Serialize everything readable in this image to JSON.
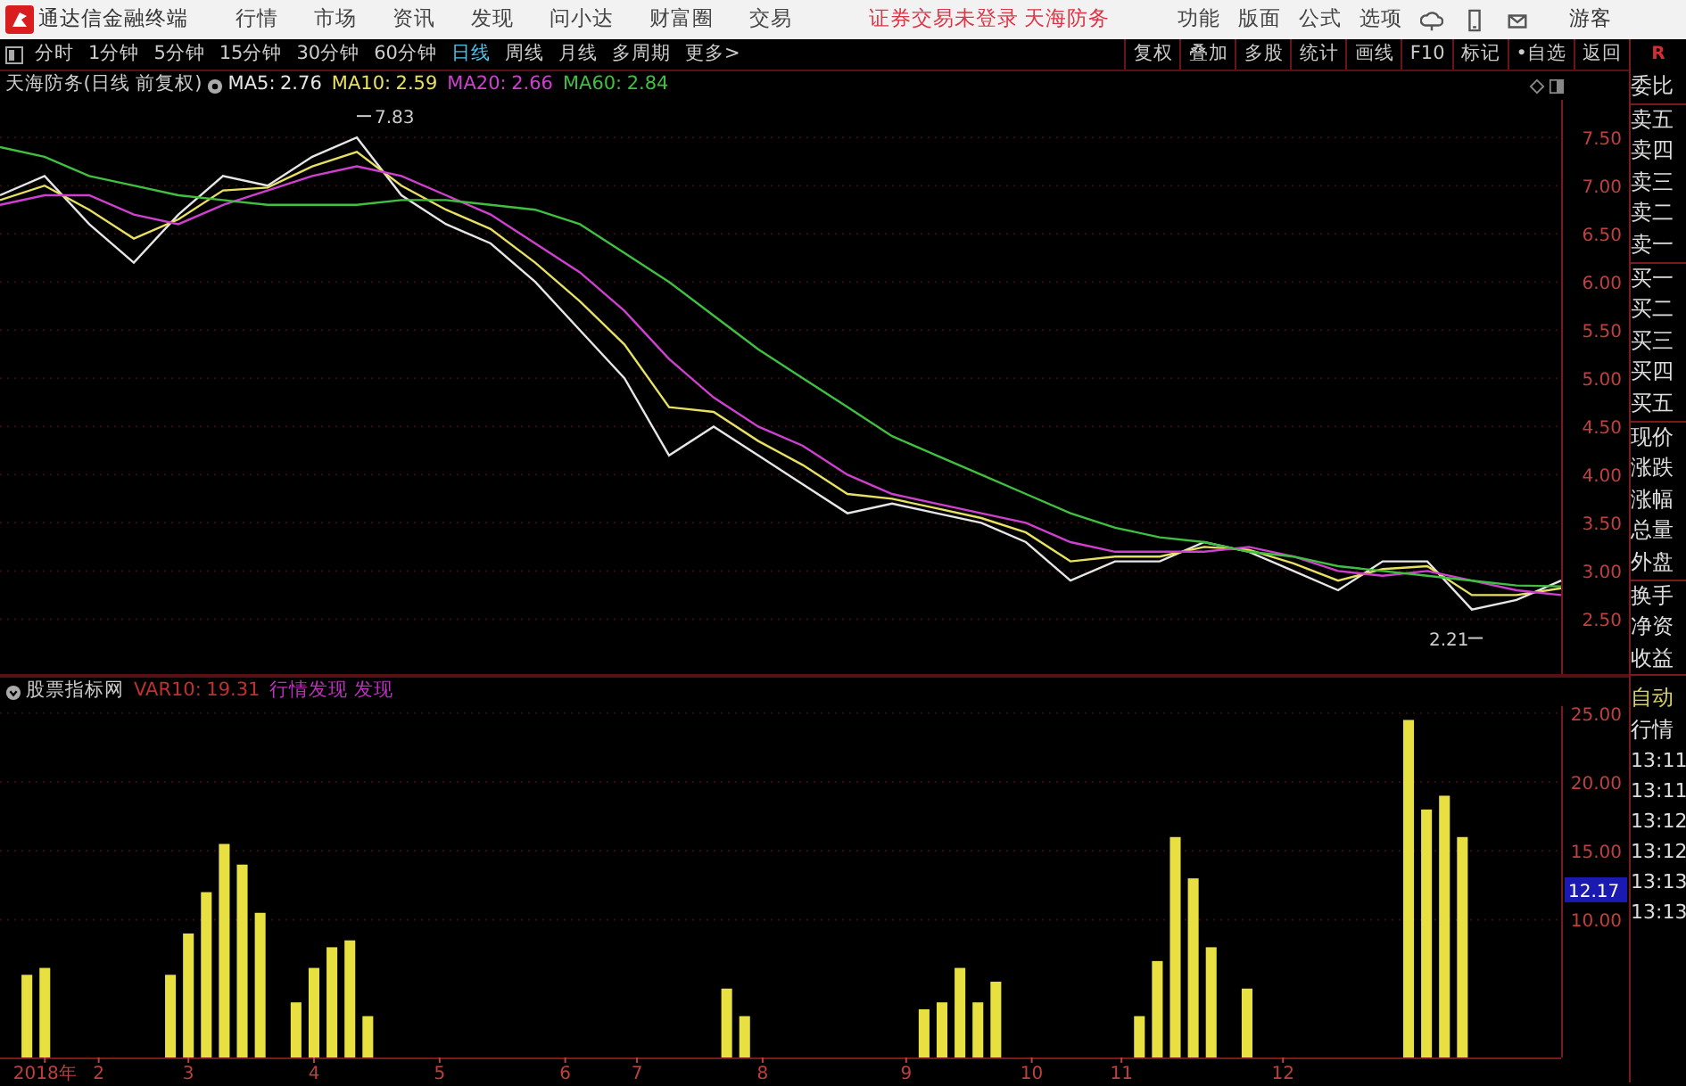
{
  "title_bar": {
    "app_name": "通达信金融终端",
    "menus": [
      "行情",
      "市场",
      "资讯",
      "发现",
      "问小达",
      "财富圈",
      "交易"
    ],
    "status": "证券交易未登录",
    "stock": "天海防务",
    "right_menus": [
      "功能",
      "版面",
      "公式",
      "选项"
    ],
    "user": "游客"
  },
  "toolbar": {
    "periods": [
      {
        "label": "分时",
        "selected": false
      },
      {
        "label": "1分钟",
        "selected": false
      },
      {
        "label": "5分钟",
        "selected": false
      },
      {
        "label": "15分钟",
        "selected": false
      },
      {
        "label": "30分钟",
        "selected": false
      },
      {
        "label": "60分钟",
        "selected": false
      },
      {
        "label": "日线",
        "selected": true
      },
      {
        "label": "周线",
        "selected": false
      },
      {
        "label": "月线",
        "selected": false
      },
      {
        "label": "多周期",
        "selected": false
      },
      {
        "label": "更多>",
        "selected": false
      }
    ],
    "buttons": [
      "复权",
      "叠加",
      "多股",
      "统计",
      "画线",
      "F10",
      "标记",
      "•自选",
      "返回"
    ]
  },
  "header_badge": "R",
  "price_chart": {
    "title": "天海防务(日线 前复权)",
    "indicators": [
      {
        "value": "2.76"
      },
      {
        "value": "2.59"
      },
      {
        "value": "2.66"
      },
      {
        "value": "2.84"
      }
    ],
    "chart_data": {
      "type": "line",
      "grid": true,
      "ylim": [
        1.93,
        7.89
      ],
      "yticks": [
        {
          "value": 2.5,
          "label": "2.50"
        },
        {
          "value": 3,
          "label": "3.00"
        },
        {
          "value": 3.5,
          "label": "3.50"
        },
        {
          "value": 4,
          "label": "4.00"
        },
        {
          "value": 4.5,
          "label": "4.50"
        },
        {
          "value": 5,
          "label": "5.00"
        },
        {
          "value": 5.5,
          "label": "5.50"
        },
        {
          "value": 6,
          "label": "6.00"
        },
        {
          "value": 6.5,
          "label": "6.50"
        },
        {
          "value": 7,
          "label": "7.00"
        },
        {
          "value": 7.5,
          "label": "7.50"
        }
      ],
      "series": [
        {
          "name": "MA5:",
          "color": "#e6e6e6",
          "values": [
            6.9,
            7.1,
            6.6,
            6.2,
            6.7,
            7.1,
            7.0,
            7.3,
            7.5,
            6.9,
            6.6,
            6.4,
            6.0,
            5.5,
            5.0,
            4.2,
            4.5,
            4.2,
            3.9,
            3.6,
            3.7,
            3.6,
            3.5,
            3.3,
            2.9,
            3.1,
            3.1,
            3.3,
            3.2,
            3.0,
            2.8,
            3.1,
            3.1,
            2.6,
            2.7,
            2.9
          ]
        },
        {
          "name": "MA10:",
          "color": "#e8e060",
          "values": [
            6.85,
            7.0,
            6.75,
            6.45,
            6.65,
            6.95,
            6.98,
            7.2,
            7.35,
            7.0,
            6.75,
            6.55,
            6.2,
            5.8,
            5.35,
            4.7,
            4.65,
            4.35,
            4.1,
            3.8,
            3.75,
            3.65,
            3.55,
            3.4,
            3.1,
            3.15,
            3.15,
            3.25,
            3.22,
            3.08,
            2.9,
            3.02,
            3.05,
            2.75,
            2.75,
            2.82
          ]
        },
        {
          "name": "MA20:",
          "color": "#d040d0",
          "values": [
            6.8,
            6.9,
            6.9,
            6.7,
            6.6,
            6.8,
            6.95,
            7.1,
            7.2,
            7.1,
            6.9,
            6.7,
            6.4,
            6.1,
            5.7,
            5.2,
            4.8,
            4.5,
            4.3,
            4.0,
            3.8,
            3.7,
            3.6,
            3.5,
            3.3,
            3.2,
            3.2,
            3.2,
            3.25,
            3.15,
            3.0,
            2.95,
            3.0,
            2.9,
            2.8,
            2.75
          ]
        },
        {
          "name": "MA60:",
          "color": "#40c040",
          "values": [
            7.4,
            7.3,
            7.1,
            7.0,
            6.9,
            6.85,
            6.8,
            6.8,
            6.8,
            6.85,
            6.85,
            6.8,
            6.75,
            6.6,
            6.3,
            6.0,
            5.65,
            5.3,
            5.0,
            4.7,
            4.4,
            4.2,
            4.0,
            3.8,
            3.6,
            3.45,
            3.35,
            3.3,
            3.2,
            3.15,
            3.05,
            3.0,
            2.95,
            2.9,
            2.85,
            2.84
          ]
        }
      ],
      "annotations": [
        "7.83",
        "2.21"
      ]
    }
  },
  "indicator_chart": {
    "title": "股票指标网",
    "indicators": [
      {
        "value": "19.31"
      }
    ],
    "tags": "行情发现 发现",
    "chart_data": {
      "type": "bar",
      "grid": true,
      "ylim": [
        0,
        25.5
      ],
      "yticks": [
        {
          "value": 10,
          "label": "10.00"
        },
        {
          "value": 15,
          "label": "15.00"
        },
        {
          "value": 20,
          "label": "20.00"
        },
        {
          "value": 25,
          "label": "25.00"
        }
      ],
      "categories": [
        null,
        null,
        "2018年",
        null,
        null,
        "2",
        null,
        null,
        null,
        null,
        "3",
        null,
        null,
        null,
        null,
        null,
        null,
        "4",
        null,
        null,
        null,
        null,
        null,
        null,
        "5",
        null,
        null,
        null,
        null,
        null,
        null,
        "6",
        null,
        null,
        null,
        "7",
        null,
        null,
        null,
        null,
        null,
        null,
        "8",
        null,
        null,
        null,
        null,
        null,
        null,
        null,
        "9",
        null,
        null,
        null,
        null,
        null,
        null,
        "10",
        null,
        null,
        null,
        null,
        "11",
        null,
        null,
        null,
        null,
        null,
        null,
        null,
        null,
        "12",
        null,
        null,
        null,
        null,
        null,
        null,
        null,
        null,
        null,
        null,
        null,
        null,
        null,
        null,
        null
      ],
      "series": [
        {
          "name": "VAR10:",
          "color": "#e8e040",
          "values": [
            null,
            6,
            6.5,
            null,
            null,
            null,
            null,
            null,
            null,
            6,
            9,
            12,
            15.5,
            14,
            10.5,
            null,
            4,
            6.5,
            8,
            8.5,
            3,
            null,
            null,
            null,
            null,
            null,
            null,
            null,
            null,
            null,
            null,
            null,
            null,
            null,
            null,
            null,
            null,
            null,
            null,
            null,
            5,
            3,
            null,
            null,
            null,
            null,
            null,
            null,
            null,
            null,
            null,
            3.5,
            4,
            6.5,
            4,
            5.5,
            null,
            null,
            null,
            null,
            null,
            null,
            null,
            3,
            7,
            16,
            13,
            8,
            null,
            5,
            null,
            null,
            null,
            null,
            null,
            null,
            null,
            null,
            24.5,
            18,
            19,
            16,
            null,
            null,
            null,
            null,
            null
          ]
        }
      ],
      "annotations": [
        {
          "y": 12.17,
          "text": "12.17"
        }
      ]
    }
  },
  "quote_panel": {
    "groups": [
      [
        "委比"
      ],
      [
        "卖五",
        "卖四",
        "卖三",
        "卖二",
        "卖一"
      ],
      [
        "买一",
        "买二",
        "买三",
        "买四",
        "买五"
      ],
      [
        "现价",
        "涨跌",
        "涨幅",
        "总量",
        "外盘"
      ],
      [
        "换手",
        "净资",
        "收益"
      ]
    ],
    "modes": [
      "自动",
      "行情"
    ],
    "times": [
      "13:11",
      "13:11",
      "13:12",
      "13:12",
      "13:13",
      "13:13"
    ]
  }
}
